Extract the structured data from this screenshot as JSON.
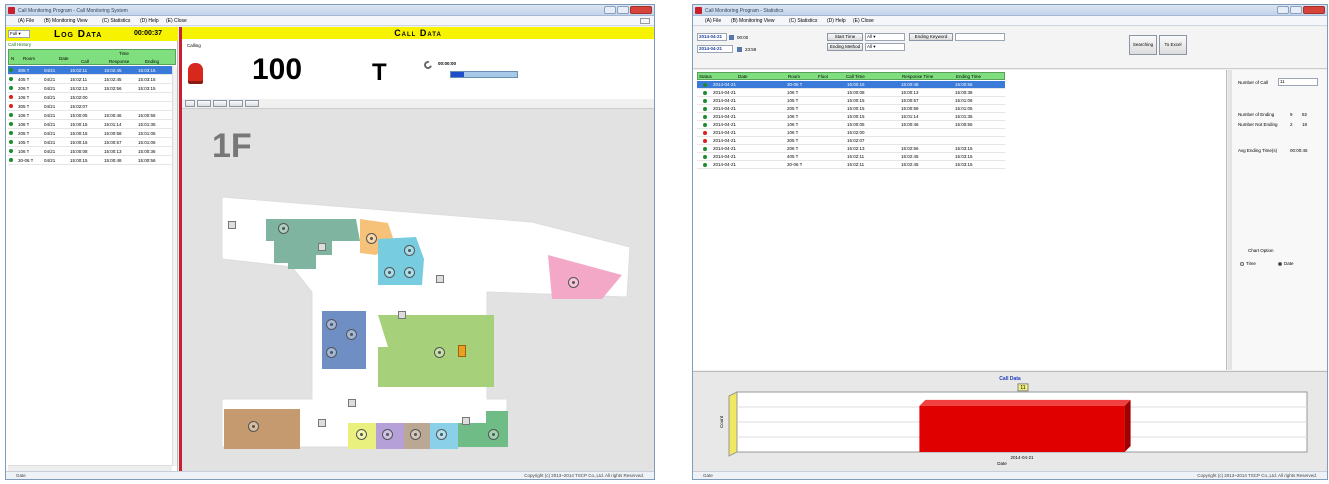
{
  "window1": {
    "title": "Call Monitoring Program - Call Monitoring System",
    "menu": [
      "(A) File",
      "(B) Monitoring View",
      "(C) Statistics",
      "(D) Help",
      "(E) Close"
    ],
    "floor_select": "Full",
    "log_title": "Log Data",
    "log_time": "00:00:37",
    "call_history_label": "Call History",
    "log_headers": {
      "no": "N",
      "room": "Room",
      "date": "Date",
      "time_group": "Time",
      "call": "Call",
      "response": "Response",
      "ending": "Ending"
    },
    "log_rows": [
      {
        "status": "green",
        "room": "305 T",
        "date": "04/21",
        "call": "15:02:11",
        "response": "15:02:45",
        "ending": "15:03:15"
      },
      {
        "status": "green",
        "room": "405 T",
        "date": "04/21",
        "call": "15:02:11",
        "response": "15:02:45",
        "ending": "15:03:15"
      },
      {
        "status": "green",
        "room": "206 T",
        "date": "04/21",
        "call": "15:02:13",
        "response": "15:02:56",
        "ending": "15:03:15"
      },
      {
        "status": "red",
        "room": "106 T",
        "date": "04/21",
        "call": "15:02:00",
        "response": "",
        "ending": ""
      },
      {
        "status": "red",
        "room": "305 T",
        "date": "04/21",
        "call": "15:02:07",
        "response": "",
        "ending": ""
      },
      {
        "status": "green",
        "room": "106 T",
        "date": "04/21",
        "call": "15:00:05",
        "response": "15:00:46",
        "ending": "15:00:55"
      },
      {
        "status": "green",
        "room": "106 T",
        "date": "04/21",
        "call": "15:00:15",
        "response": "15:01:14",
        "ending": "15:01:35"
      },
      {
        "status": "green",
        "room": "205 T",
        "date": "04/21",
        "call": "15:00:15",
        "response": "15:00:58",
        "ending": "15:01:05"
      },
      {
        "status": "green",
        "room": "105 T",
        "date": "04/21",
        "call": "15:00:15",
        "response": "15:00:57",
        "ending": "15:01:06"
      },
      {
        "status": "green",
        "room": "106 T",
        "date": "04/21",
        "call": "15:00:08",
        "response": "15:00:13",
        "ending": "15:00:36"
      },
      {
        "status": "green",
        "room": "30-06 T",
        "date": "04/21",
        "call": "15:00:15",
        "response": "15:00:48",
        "ending": "15:00:56"
      }
    ],
    "call_data_title": "Call Data",
    "calling_label": "Calling",
    "call_number": "100",
    "call_type": "T",
    "small_time": "00:00:00",
    "floor_label": "1F",
    "status_left": "Gate",
    "copyright": "Copyright (c) 2013~2014 TSCP Co.,Ltd. All rights Reserved."
  },
  "window2": {
    "title": "Call Monitoring Program - Statistics",
    "menu": [
      "(A) File",
      "(B) Monitoring View",
      "(C) Statistics",
      "(D) Help",
      "(E) Close"
    ],
    "date_from": "2014-04-21",
    "date_to": "2014-04-21",
    "time_from": "00:00",
    "time_to": "23:59",
    "start_time_label": "Start Time",
    "start_time_value": "All",
    "ending_method_label": "Ending Method",
    "ending_method_value": "All",
    "ending_keyword_label": "Ending Keyword",
    "search_button": "Searching",
    "excel_button": "To Excel",
    "headers": [
      "Status",
      "Date",
      "Room",
      "Floor",
      "Call Time",
      "Response Time",
      "Ending Time"
    ],
    "rows": [
      {
        "status": "green",
        "date": "2014-04-21",
        "room": "30-06 T",
        "floor": "",
        "call": "15:00:15",
        "response": "15:00:48",
        "ending": "15:00:56"
      },
      {
        "status": "green",
        "date": "2014-04-21",
        "room": "106 T",
        "floor": "",
        "call": "15:00:08",
        "response": "15:00:13",
        "ending": "15:00:36"
      },
      {
        "status": "green",
        "date": "2014-04-21",
        "room": "105 T",
        "floor": "",
        "call": "15:00:15",
        "response": "15:00:57",
        "ending": "15:01:06"
      },
      {
        "status": "green",
        "date": "2014-04-21",
        "room": "205 T",
        "floor": "",
        "call": "15:00:15",
        "response": "15:00:58",
        "ending": "15:01:05"
      },
      {
        "status": "green",
        "date": "2014-04-21",
        "room": "106 T",
        "floor": "",
        "call": "15:00:15",
        "response": "15:01:14",
        "ending": "15:01:35"
      },
      {
        "status": "green",
        "date": "2014-04-21",
        "room": "106 T",
        "floor": "",
        "call": "15:00:05",
        "response": "15:00:46",
        "ending": "15:00:55"
      },
      {
        "status": "red",
        "date": "2014-04-21",
        "room": "106 T",
        "floor": "",
        "call": "15:02:00",
        "response": "",
        "ending": ""
      },
      {
        "status": "red",
        "date": "2014-04-21",
        "room": "305 T",
        "floor": "",
        "call": "15:02:07",
        "response": "",
        "ending": ""
      },
      {
        "status": "green",
        "date": "2014-04-21",
        "room": "206 T",
        "floor": "",
        "call": "15:02:13",
        "response": "15:02:56",
        "ending": "15:03:15"
      },
      {
        "status": "green",
        "date": "2014-04-21",
        "room": "405 T",
        "floor": "",
        "call": "15:02:11",
        "response": "15:02:45",
        "ending": "15:03:15"
      },
      {
        "status": "green",
        "date": "2014-04-21",
        "room": "30-06 T",
        "floor": "",
        "call": "15:02:11",
        "response": "15:02:45",
        "ending": "15:03:15"
      }
    ],
    "side": {
      "number_of_call_label": "Number of Call",
      "number_of_call": "11",
      "ending_count_label": "Number of Ending",
      "ending_count": "9",
      "ending_pct": "82",
      "not_ending_label": "Number Not Ending",
      "not_ending": "2",
      "not_ending_pct": "18",
      "avg_label": "Avg Ending Time(s)",
      "avg_value": "00:00:45",
      "chart_option_label": "Chart Option",
      "opt_time": "Time",
      "opt_date": "Date"
    },
    "status_left": "Gate",
    "copyright": "Copyright (c) 2013~2014 TSCP Co.,Ltd. All rights Reserved."
  },
  "chart_data": {
    "type": "bar",
    "title": "Call Data",
    "categories": [
      "2014-04-21"
    ],
    "values": [
      11
    ],
    "xlabel": "Date",
    "ylabel": "Count",
    "bar_color": "#e00000",
    "data_label": "11"
  }
}
